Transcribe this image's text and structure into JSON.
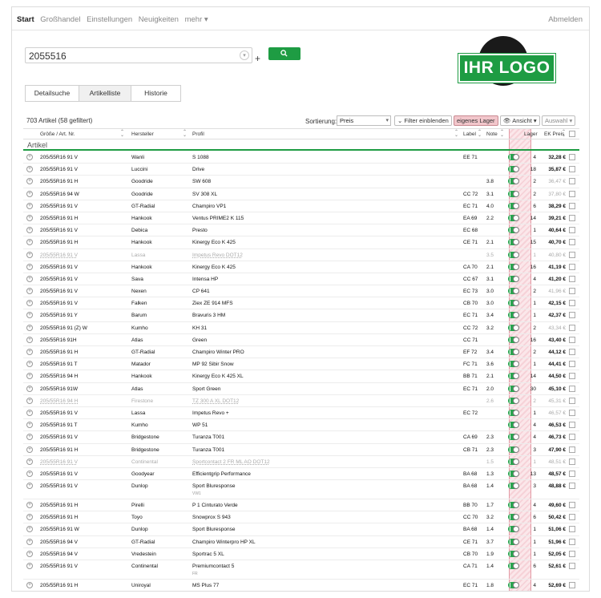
{
  "nav": {
    "items": [
      "Start",
      "Großhandel",
      "Einstellungen",
      "Neuigkeiten",
      "mehr ▾"
    ],
    "logout": "Abmelden"
  },
  "search": {
    "value": "2055516",
    "plus": "+"
  },
  "logo": {
    "text": "IHR LOGO"
  },
  "tabs": [
    "Detailsuche",
    "Artikelliste",
    "Historie"
  ],
  "toolbar": {
    "count": "703 Artikel (58 gefiltert)",
    "sort_label": "Sortierung:",
    "sort_value": "Preis",
    "filter_button": "Filter einblenden",
    "lager_button": "eigenes Lager",
    "view_button": "Ansicht",
    "select_button": "Auswahl"
  },
  "columns": {
    "size": "Größe / Art. Nr.",
    "maker": "Hersteller",
    "profile": "Profil",
    "label": "Label",
    "note": "Note",
    "lager": "Lager",
    "price": "EK Preis"
  },
  "group": "Artikel",
  "colors": {
    "accent": "#1e9c43",
    "lager_highlight": "#f2c6cb"
  },
  "rows": [
    {
      "size": "205/55R16 91 V",
      "maker": "Wanli",
      "profile": "S 1088",
      "label": "EE 71",
      "note": "",
      "stock": "4",
      "price": "32,28 €",
      "dim": false
    },
    {
      "size": "205/55R16 91 V",
      "maker": "Luccini",
      "profile": "Drive",
      "label": "",
      "note": "",
      "stock": "18",
      "price": "35,87 €",
      "dim": false
    },
    {
      "size": "205/55R16 91 H",
      "maker": "Goodride",
      "profile": "SW 608",
      "label": "",
      "note": "3.8",
      "stock": "2",
      "price": "36,47 €",
      "dim": false,
      "price_dim": true
    },
    {
      "size": "205/55R16 94 W",
      "maker": "Goodride",
      "profile": "SV 308 XL",
      "label": "CC 72",
      "note": "3.1",
      "stock": "2",
      "price": "37,80 €",
      "dim": false,
      "price_dim": true
    },
    {
      "size": "205/55R16 91 V",
      "maker": "GT-Radial",
      "profile": "Champiro VP1",
      "label": "EC 71",
      "note": "4.0",
      "stock": "6",
      "price": "38,29 €",
      "dim": false
    },
    {
      "size": "205/55R16 91 H",
      "maker": "Hankook",
      "profile": "Ventus PRIME2 K 115",
      "label": "EA 69",
      "note": "2.2",
      "stock": "14",
      "price": "39,21 €",
      "dim": false
    },
    {
      "size": "205/55R16 91 V",
      "maker": "Debica",
      "profile": "Presto",
      "label": "EC 68",
      "note": "",
      "stock": "1",
      "price": "40,64 €",
      "dim": false
    },
    {
      "size": "205/55R16 91 H",
      "maker": "Hankook",
      "profile": "Kinergy Eco K 425",
      "label": "CE 71",
      "note": "2.1",
      "stock": "15",
      "price": "40,70 €",
      "dim": false
    },
    {
      "size": "205/55R16 91 V",
      "maker": "Lassa",
      "profile": "Impetus Revo DOT12",
      "label": "",
      "note": "3.5",
      "stock": "1",
      "price": "40,80 €",
      "dim": true
    },
    {
      "size": "205/55R16 91 V",
      "maker": "Hankook",
      "profile": "Kinergy Eco K 425",
      "label": "CA 70",
      "note": "2.1",
      "stock": "16",
      "price": "41,19 €",
      "dim": false
    },
    {
      "size": "205/55R16 91 V",
      "maker": "Sava",
      "profile": "Intensa HP",
      "label": "CC 67",
      "note": "3.1",
      "stock": "4",
      "price": "41,20 €",
      "dim": false
    },
    {
      "size": "205/55R16 91 V",
      "maker": "Nexen",
      "profile": "CP 641",
      "label": "EC 73",
      "note": "3.0",
      "stock": "2",
      "price": "41,96 €",
      "dim": false,
      "price_dim": true
    },
    {
      "size": "205/55R16 91 V",
      "maker": "Falken",
      "profile": "Ziex ZE 914 MFS",
      "label": "CB 70",
      "note": "3.0",
      "stock": "1",
      "price": "42,15 €",
      "dim": false
    },
    {
      "size": "205/55R16 91 Y",
      "maker": "Barum",
      "profile": "Bravuris 3 HM",
      "label": "EC 71",
      "note": "3.4",
      "stock": "1",
      "price": "42,37 €",
      "dim": false
    },
    {
      "size": "205/55R16 91 (Z) W",
      "maker": "Kumho",
      "profile": "KH 31",
      "label": "CC 72",
      "note": "3.2",
      "stock": "2",
      "price": "43,34 €",
      "dim": false,
      "price_dim": true
    },
    {
      "size": "205/55R16 91H",
      "maker": "Atlas",
      "profile": "Green",
      "label": "CC 71",
      "note": "",
      "stock": "16",
      "price": "43,40 €",
      "dim": false
    },
    {
      "size": "205/55R16 91 H",
      "maker": "GT-Radial",
      "profile": "Champiro Winter PRO",
      "label": "EF 72",
      "note": "3.4",
      "stock": "2",
      "price": "44,12 €",
      "dim": false
    },
    {
      "size": "205/55R16 91 T",
      "maker": "Matador",
      "profile": "MP 92 Sibir Snow",
      "label": "FC 71",
      "note": "3.6",
      "stock": "1",
      "price": "44,41 €",
      "dim": false
    },
    {
      "size": "205/55R16 94 H",
      "maker": "Hankook",
      "profile": "Kinergy Eco K 425 XL",
      "label": "BB 71",
      "note": "2.1",
      "stock": "14",
      "price": "44,50 €",
      "dim": false
    },
    {
      "size": "205/55R16 91W",
      "maker": "Atlas",
      "profile": "Sport Green",
      "label": "EC 71",
      "note": "2.0",
      "stock": "30",
      "price": "45,10 €",
      "dim": false
    },
    {
      "size": "205/55R16 94 H",
      "maker": "Firestone",
      "profile": "TZ 300 A XL DOT12",
      "label": "",
      "note": "2.6",
      "stock": "2",
      "price": "45,31 €",
      "dim": true
    },
    {
      "size": "205/55R16 91 V",
      "maker": "Lassa",
      "profile": "Impetus Revo +",
      "label": "EC 72",
      "note": "",
      "stock": "1",
      "price": "46,57 €",
      "dim": false,
      "price_dim": true
    },
    {
      "size": "205/55R16 91 T",
      "maker": "Kumho",
      "profile": "WP 51",
      "label": "",
      "note": "",
      "stock": "4",
      "price": "46,53 €",
      "dim": false
    },
    {
      "size": "205/55R16 91 V",
      "maker": "Bridgestone",
      "profile": "Turanza T001",
      "label": "CA 69",
      "note": "2.3",
      "stock": "4",
      "price": "46,73 €",
      "dim": false
    },
    {
      "size": "205/55R16 91 H",
      "maker": "Bridgestone",
      "profile": "Turanza T001",
      "label": "CB 71",
      "note": "2.3",
      "stock": "3",
      "price": "47,90 €",
      "dim": false
    },
    {
      "size": "205/55R16 91 V",
      "maker": "Continental",
      "profile": "Sportcontact 2 FR ML AO DOT12",
      "label": "",
      "note": "1.5",
      "stock": "1",
      "price": "48,51 €",
      "dim": true
    },
    {
      "size": "205/55R16 91 V",
      "maker": "Goodyear",
      "profile": "Efficientgrip Performance",
      "label": "BA 68",
      "note": "1.3",
      "stock": "13",
      "price": "48,57 €",
      "dim": false
    },
    {
      "size": "205/55R16 91 V",
      "maker": "Dunlop",
      "profile": "Sport Bluresponse",
      "label": "BA 68",
      "note": "1.4",
      "stock": "3",
      "price": "48,88 €",
      "dim": false,
      "sub": "VW1",
      "tall": true
    },
    {
      "size": "205/55R16 91 H",
      "maker": "Pirelli",
      "profile": "P 1 Cinturato Verde",
      "label": "BB 70",
      "note": "1.7",
      "stock": "4",
      "price": "49,60 €",
      "dim": false
    },
    {
      "size": "205/55R16 91 H",
      "maker": "Toyo",
      "profile": "Snowprox S 943",
      "label": "CC 70",
      "note": "3.2",
      "stock": "6",
      "price": "50,42 €",
      "dim": false
    },
    {
      "size": "205/55R16 91 W",
      "maker": "Dunlop",
      "profile": "Sport Bluresponse",
      "label": "BA 68",
      "note": "1.4",
      "stock": "1",
      "price": "51,06 €",
      "dim": false
    },
    {
      "size": "205/55R16 94 V",
      "maker": "GT-Radial",
      "profile": "Champiro Winterpro HP XL",
      "label": "CE 71",
      "note": "3.7",
      "stock": "1",
      "price": "51,96 €",
      "dim": false
    },
    {
      "size": "205/55R16 94 V",
      "maker": "Vredestein",
      "profile": "Sportrac 5 XL",
      "label": "CB 70",
      "note": "1.9",
      "stock": "1",
      "price": "52,05 €",
      "dim": false
    },
    {
      "size": "205/55R16 91 V",
      "maker": "Continental",
      "profile": "Premiumcontact 5",
      "label": "CA 71",
      "note": "1.4",
      "stock": "6",
      "price": "52,61 €",
      "dim": false,
      "sub": "FR",
      "tall": true
    },
    {
      "size": "205/55R16 91 H",
      "maker": "Uniroyal",
      "profile": "MS Plus 77",
      "label": "EC 71",
      "note": "1.8",
      "stock": "4",
      "price": "52,69 €",
      "dim": false,
      "tall": true
    }
  ]
}
